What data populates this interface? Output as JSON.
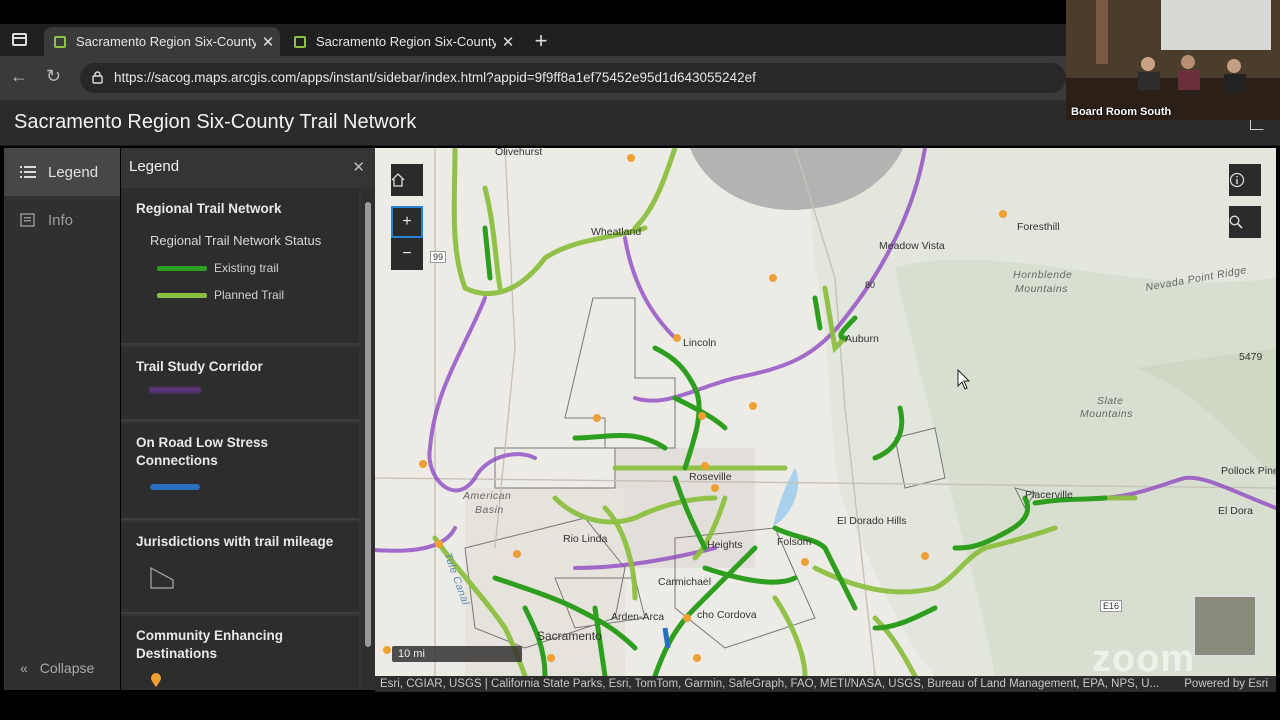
{
  "browser": {
    "tabs": [
      {
        "title": "Sacramento Region Six-County Tr",
        "active": true
      },
      {
        "title": "Sacramento Region Six-County Tr",
        "active": false
      }
    ],
    "url": "https://sacog.maps.arcgis.com/apps/instant/sidebar/index.html?appid=9f9ff8a1ef75452e95d1d643055242ef"
  },
  "app": {
    "title": "Sacramento Region Six-County Trail Network"
  },
  "sidebar": {
    "items": [
      {
        "label": "Legend",
        "icon": "list-icon",
        "active": true
      },
      {
        "label": "Info",
        "icon": "info-panel-icon",
        "active": false
      }
    ],
    "collapse_label": "Collapse"
  },
  "legend": {
    "title": "Legend",
    "sections": [
      {
        "title": "Regional Trail Network",
        "subtitle": "Regional Trail Network Status",
        "items": [
          {
            "label": "Existing trail",
            "color": "#2e9e1f"
          },
          {
            "label": "Planned Trail",
            "color": "#8cbf3f"
          }
        ]
      },
      {
        "title": "Trail Study Corridor",
        "color": "#7a3aa8"
      },
      {
        "title": "On Road Low Stress Connections",
        "color": "#2a6fbf"
      },
      {
        "title": "Jurisdictions with trail mileage"
      },
      {
        "title": "Community Enhancing Destinations",
        "color": "#f0a030"
      }
    ]
  },
  "map": {
    "scale_label": "10 mi",
    "attribution": "Esri, CGIAR, USGS | California State Parks, Esri, TomTom, Garmin, SafeGraph, FAO, METI/NASA, USGS, Bureau of Land Management, EPA, NPS, U...",
    "powered_by": "Powered by Esri",
    "places": {
      "olivehurst": "Olivehurst",
      "wheatland": "Wheatland",
      "meadow_vista": "Meadow Vista",
      "foresthill": "Foresthill",
      "hornblende": "Hornblende",
      "mountains": "Mountains",
      "nevada_point_ridge": "Nevada Point Ridge",
      "lincoln": "Lincoln",
      "auburn": "Auburn",
      "slate": "Slate",
      "slate_mountains": "Mountains",
      "roseville": "Roseville",
      "pollock_pines": "Pollock Pines",
      "el_dorado": "El Dora",
      "american": "American",
      "basin": "Basin",
      "el_dorado_hills": "El Dorado Hills",
      "placerville": "Placerville",
      "rio_linda": "Rio Linda",
      "heights": "Heights",
      "folsom": "Folsom",
      "carmichael": "Carmichael",
      "arden_arcade": "Arden-Arca",
      "rancho_cordova": "cho Cordova",
      "sacramento": "Sacramento",
      "tule_canal": "Tule Canal",
      "elev": "5479",
      "hwy99": "99",
      "hwy80": "80",
      "e16": "E16"
    }
  },
  "video": {
    "label": "Board Room South"
  },
  "watermark": "zoom"
}
